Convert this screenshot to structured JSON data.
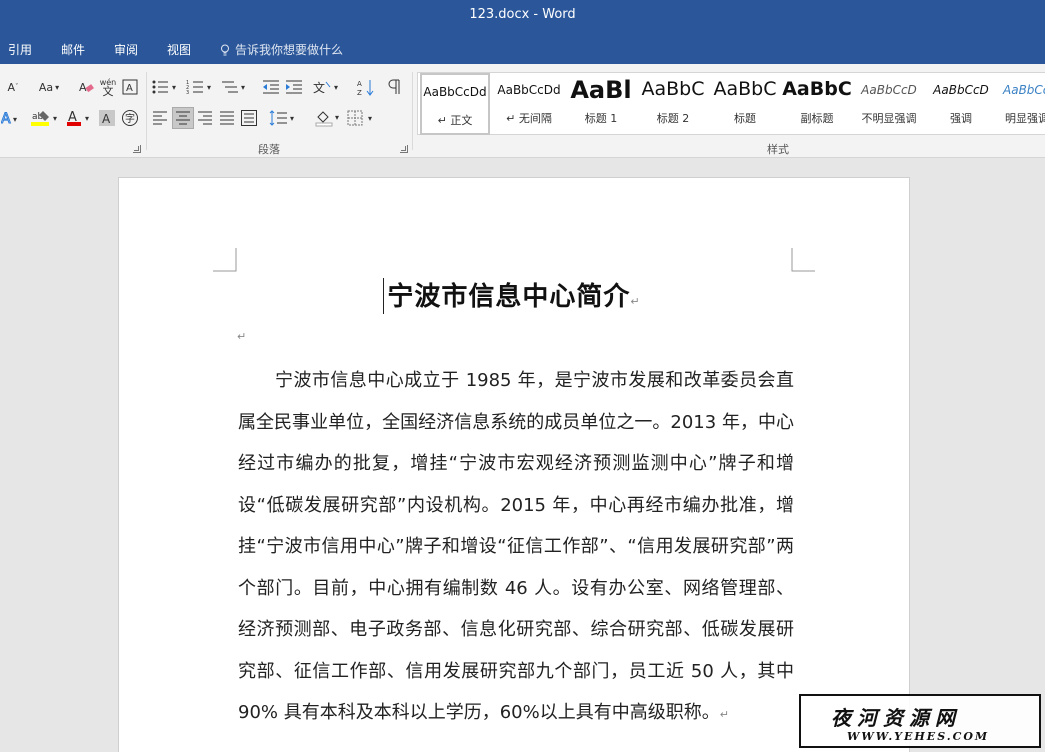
{
  "window": {
    "title": "123.docx  -  Word"
  },
  "tabs": [
    "引用",
    "邮件",
    "审阅",
    "视图"
  ],
  "tell_me": "告诉我你想要做什么",
  "ribbon": {
    "font_size_small": "A",
    "change_case": "Aa",
    "phonetic": "wén",
    "group_paragraph": "段落",
    "group_styles": "样式",
    "styles": [
      {
        "preview": "AaBbCcDd",
        "label": "↵ 正文"
      },
      {
        "preview": "AaBbCcDd",
        "label": "↵ 无间隔"
      },
      {
        "preview": "AaBl",
        "label": "标题 1"
      },
      {
        "preview": "AaBbC",
        "label": "标题 2"
      },
      {
        "preview": "AaBbC",
        "label": "标题"
      },
      {
        "preview": "AaBbC",
        "label": "副标题"
      },
      {
        "preview": "AaBbCcD",
        "label": "不明显强调"
      },
      {
        "preview": "AaBbCcD",
        "label": "强调"
      },
      {
        "preview": "AaBbCc",
        "label": "明显强调"
      }
    ]
  },
  "document": {
    "title": "宁波市信息中心简介",
    "paragraph_mark": "↵",
    "body": "宁波市信息中心成立于 1985 年，是宁波市发展和改革委员会直属全民事业单位，全国经济信息系统的成员单位之一。2013 年，中心经过市编办的批复，增挂“宁波市宏观经济预测监测中心”牌子和增设“低碳发展研究部”内设机构。2015 年，中心再经市编办批准，增挂“宁波市信用中心”牌子和增设“征信工作部”、“信用发展研究部”两个部门。目前，中心拥有编制数 46 人。设有办公室、网络管理部、经济预测部、电子政务部、信息化研究部、综合研究部、低碳发展研究部、征信工作部、信用发展研究部九个部门，员工近 50 人，其中 90% 具有本科及本科以上学历，60%以上具有中高级职称。"
  },
  "watermark": {
    "cn": "夜河资源网",
    "en": "WWW.YEHES.COM"
  },
  "colors": {
    "accent": "#2b579a",
    "highlight_yellow": "#ffff00",
    "font_red": "#e00000"
  }
}
